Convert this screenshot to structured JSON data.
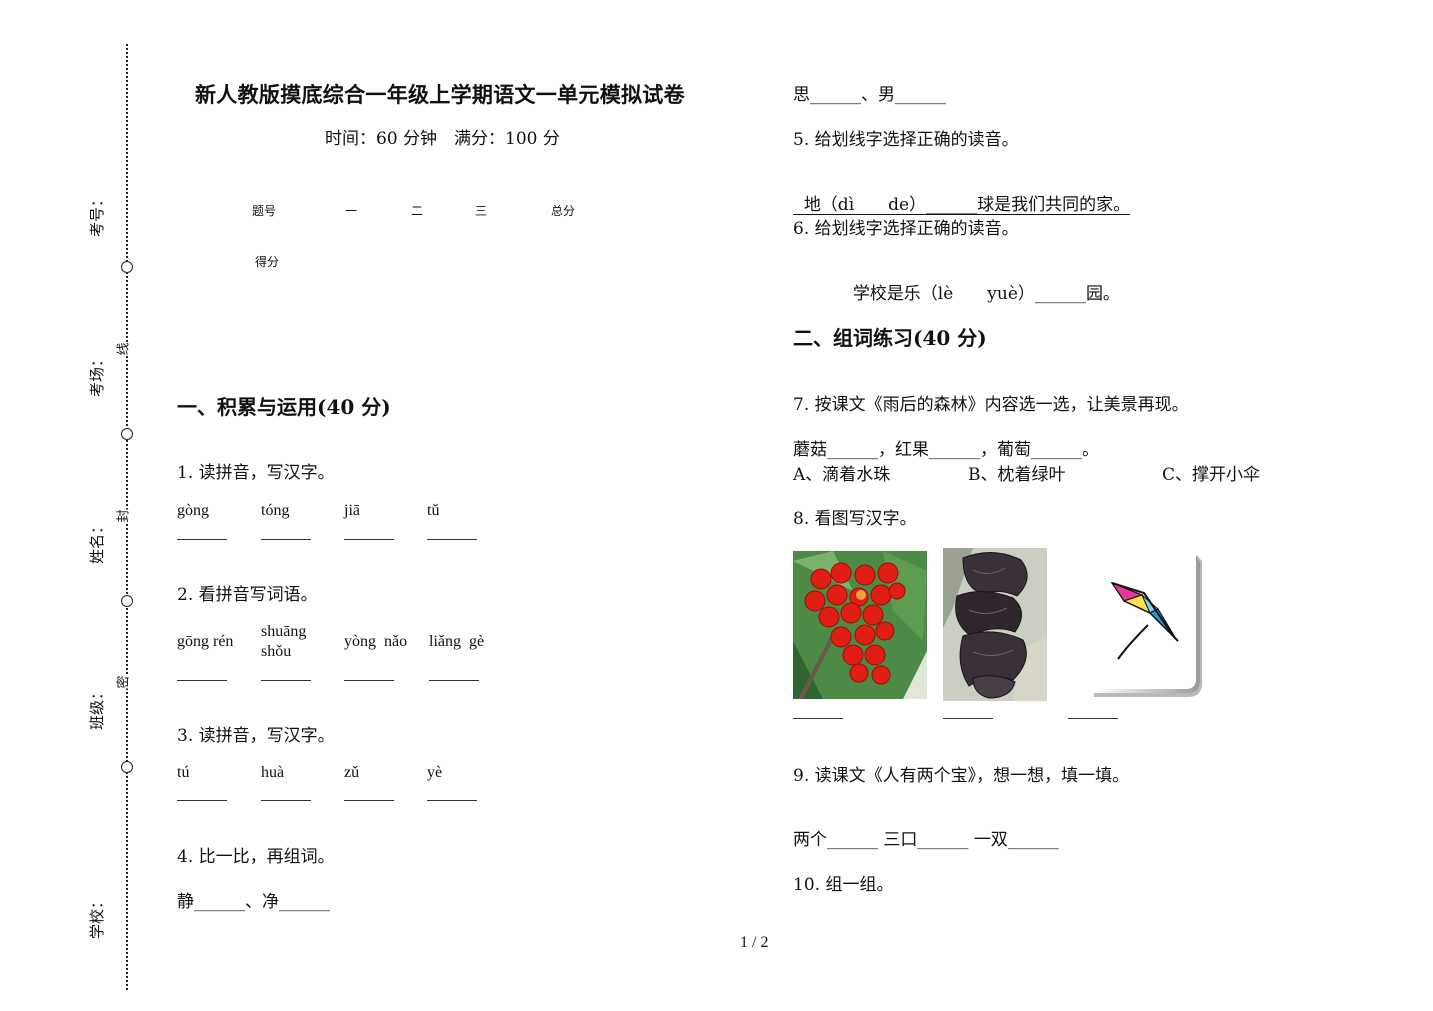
{
  "binding_margin": {
    "labels": [
      "考号：",
      "考场：",
      "姓名：",
      "班级：",
      "学校："
    ],
    "seal_marks": [
      "线",
      "封",
      "密"
    ]
  },
  "header": {
    "title": "新人教版摸底综合一年级上学期语文一单元模拟试卷",
    "subtitle": "时间：60 分钟　满分：100 分"
  },
  "score_table": {
    "headers": [
      "题号",
      "一",
      "二",
      "三",
      "总分"
    ],
    "row_label": "得分"
  },
  "section1": {
    "heading": "一、积累与运用(40 分)",
    "q1": {
      "prompt": "1.  读拼音，写汉字。",
      "pinyin": [
        "gòng",
        "tóng",
        "jiā",
        "tǔ"
      ]
    },
    "q2": {
      "prompt": "2.  看拼音写词语。",
      "pinyin": [
        "gōng rén",
        "shuāng shǒu",
        "yòng  nǎo",
        "liǎng  gè"
      ],
      "pinyin_split": [
        "shuāng",
        "shǒu"
      ]
    },
    "q3": {
      "prompt": "3.  读拼音，写汉字。",
      "pinyin": [
        "tú",
        "huà",
        "zǔ",
        "yè"
      ]
    },
    "q4": {
      "prompt": "4.  比一比，再组词。",
      "line1": [
        "静",
        "、净"
      ],
      "line2": [
        "思",
        "、男"
      ]
    }
  },
  "right_column": {
    "q5": {
      "prompt": "5.  给划线字选择正确的读音。",
      "sentence_before": "地（dì　　de）",
      "sentence_after": "球是我们共同的家。"
    },
    "q6": {
      "prompt": "6.  给划线字选择正确的读音。",
      "sentence_before": "学校是乐（lè　　yuè）",
      "sentence_after": "园。"
    }
  },
  "section2": {
    "heading": "二、组词练习(40 分)",
    "q7": {
      "prompt": "7.  按课文《雨后的森林》内容选一选，让美景再现。",
      "fill": [
        "蘑菇",
        "，红果",
        "，葡萄",
        "。"
      ],
      "options": [
        "A、滴着水珠",
        "B、枕着绿叶",
        "C、撑开小伞"
      ]
    },
    "q8": {
      "prompt": "8.  看图写汉字。",
      "images": [
        "red-berries-image",
        "black-fungus-image",
        "kite-image"
      ]
    },
    "q9": {
      "prompt": "9.  读课文《人有两个宝》，想一想，填一填。",
      "fill": [
        "两个",
        "三口",
        "一双"
      ]
    },
    "q10": {
      "prompt": "10.  组一组。"
    }
  },
  "footer": {
    "page": "1 / 2"
  },
  "blank_text": "______"
}
